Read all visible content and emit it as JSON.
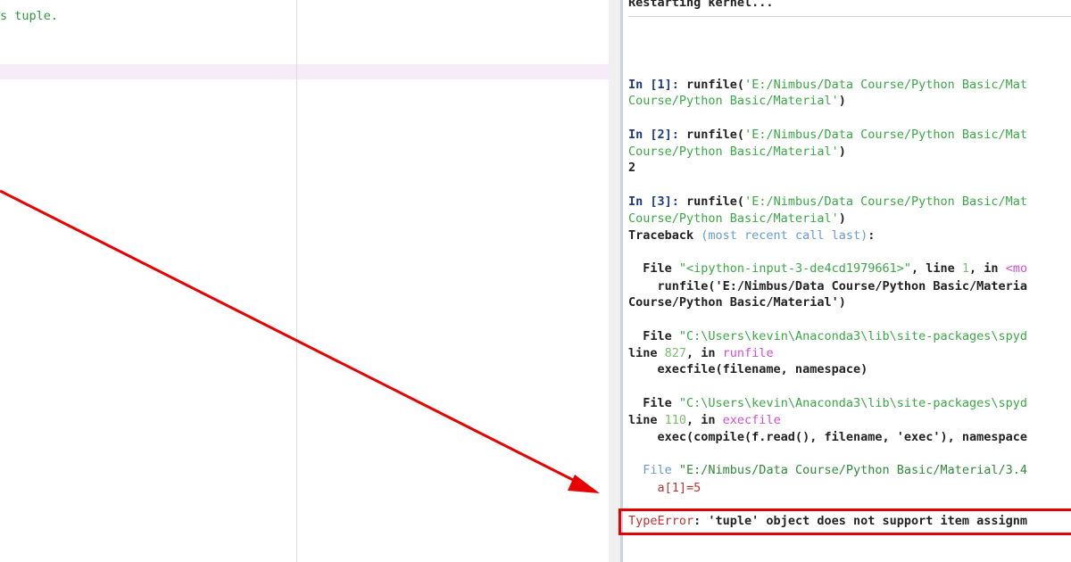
{
  "editor": {
    "visible_line": "s tuple."
  },
  "console": {
    "restart": "Restarting kernel...",
    "in1_prompt": "In [1]:",
    "in1_call": " runfile(",
    "in1_path": "'E:/Nimbus/Data Course/Python Basic/Mat",
    "in1_cont": "Course/Python Basic/Material'",
    "in2_prompt": "In [2]:",
    "in2_call": " runfile(",
    "in2_path": "'E:/Nimbus/Data Course/Python Basic/Mat",
    "in2_cont": "Course/Python Basic/Material'",
    "in2_out": "2",
    "in3_prompt": "In [3]:",
    "in3_call": " runfile(",
    "in3_path": "'E:/Nimbus/Data Course/Python Basic/Mat",
    "in3_cont": "Course/Python Basic/Material'",
    "tb_head": "Traceback ",
    "tb_note": "(most recent call last)",
    "f1_file": "  File ",
    "f1_name": "\"<ipython-input-3-de4cd1979661>\"",
    "f1_line": ", line ",
    "f1_no": "1",
    "f1_in": ", in ",
    "f1_mod": "<mo",
    "f1_code": "    runfile('E:/Nimbus/Data Course/Python Basic/Materia",
    "f1_code2": "Course/Python Basic/Material')",
    "f2_file": "  File ",
    "f2_name": "\"C:\\Users\\kevin\\Anaconda3\\lib\\site-packages\\spyd",
    "f2_line": "line ",
    "f2_no": "827",
    "f2_in": ", in ",
    "f2_fn": "runfile",
    "f2_code": "    execfile(filename, namespace)",
    "f3_file": "  File ",
    "f3_name": "\"C:\\Users\\kevin\\Anaconda3\\lib\\site-packages\\spyd",
    "f3_line": "line ",
    "f3_no": "110",
    "f3_in": ", in ",
    "f3_fn": "execfile",
    "f3_code": "    exec(compile(f.read(), filename, 'exec'), namespace",
    "f4_file": "  File ",
    "f4_name": "\"E:/Nimbus/Data Course/Python Basic/Material/3.4",
    "f4_code": "    a[1]=5",
    "err_type": "TypeError",
    "err_msg": ": 'tuple' object does not support item assignm"
  },
  "annotation": {
    "color": "#e60000"
  }
}
